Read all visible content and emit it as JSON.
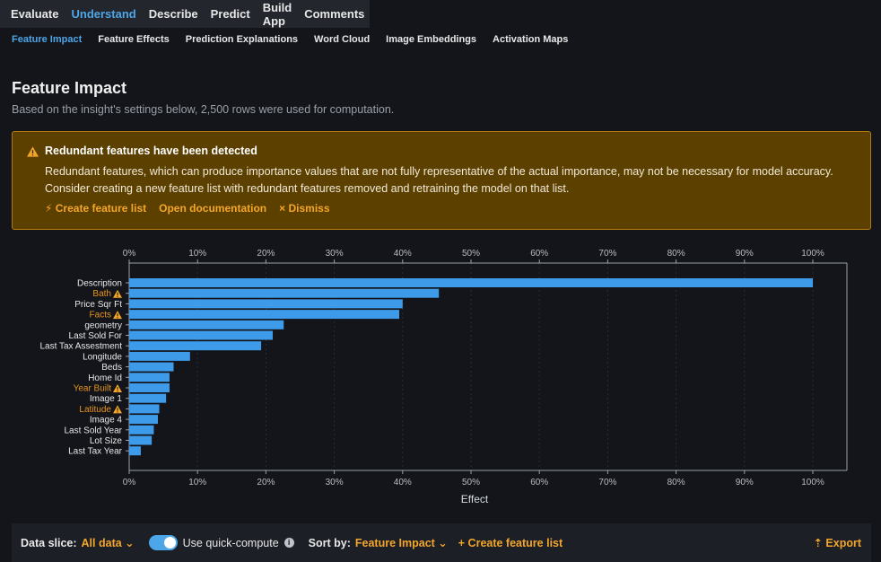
{
  "topnav": {
    "tabs": [
      {
        "label": "Evaluate",
        "active": false
      },
      {
        "label": "Understand",
        "active": true
      },
      {
        "label": "Describe",
        "active": false
      },
      {
        "label": "Predict",
        "active": false
      },
      {
        "label": "Build App",
        "active": false
      },
      {
        "label": "Comments",
        "active": false
      }
    ]
  },
  "subnav": {
    "tabs": [
      {
        "label": "Feature Impact",
        "active": true
      },
      {
        "label": "Feature Effects",
        "active": false
      },
      {
        "label": "Prediction Explanations",
        "active": false
      },
      {
        "label": "Word Cloud",
        "active": false
      },
      {
        "label": "Image Embeddings",
        "active": false
      },
      {
        "label": "Activation Maps",
        "active": false
      }
    ]
  },
  "page": {
    "title": "Feature Impact",
    "subtitle": "Based on the insight's settings below, 2,500 rows were used for computation."
  },
  "banner": {
    "title": "Redundant features have been detected",
    "body": "Redundant features, which can produce importance values that are not fully representative of the actual importance, may not be necessary for model accuracy. Consider creating a new feature list with redundant features removed and retraining the model on that list.",
    "create_label": "⚡ Create feature list",
    "docs_label": "Open documentation",
    "dismiss_label": "× Dismiss"
  },
  "chart_data": {
    "type": "bar",
    "orientation": "horizontal",
    "xlabel": "Effect",
    "xlim": [
      0,
      100
    ],
    "ticks": [
      "0%",
      "10%",
      "20%",
      "30%",
      "40%",
      "50%",
      "60%",
      "70%",
      "80%",
      "90%",
      "100%"
    ],
    "categories": [
      "Description",
      "Bath",
      "Price Sqr Ft",
      "Facts",
      "geometry",
      "Last Sold For",
      "Last Tax Assestment",
      "Longitude",
      "Beds",
      "Home Id",
      "Year Built",
      "Image 1",
      "Latitude",
      "Image 4",
      "Last Sold Year",
      "Lot Size",
      "Last Tax Year"
    ],
    "values": [
      100,
      45.3,
      40,
      39.5,
      22.6,
      21,
      19.3,
      8.9,
      6.5,
      5.9,
      5.9,
      5.4,
      4.4,
      4.2,
      3.6,
      3.3,
      1.7
    ],
    "redundant": [
      false,
      true,
      false,
      true,
      false,
      false,
      false,
      false,
      false,
      false,
      true,
      false,
      true,
      false,
      false,
      false,
      false
    ],
    "bar_color": "#3d9be9",
    "redundant_label_color": "#e8941e",
    "grid": true
  },
  "bottombar": {
    "slice_label": "Data slice:",
    "slice_value": "All data",
    "quick_compute_label": "Use quick-compute",
    "sort_label": "Sort by:",
    "sort_value": "Feature Impact",
    "create_label": "+ Create feature list",
    "export_label": "⇡ Export"
  },
  "colors": {
    "accent": "#4da6e8",
    "warning": "#f4a62a",
    "banner_bg": "#5c4000"
  }
}
